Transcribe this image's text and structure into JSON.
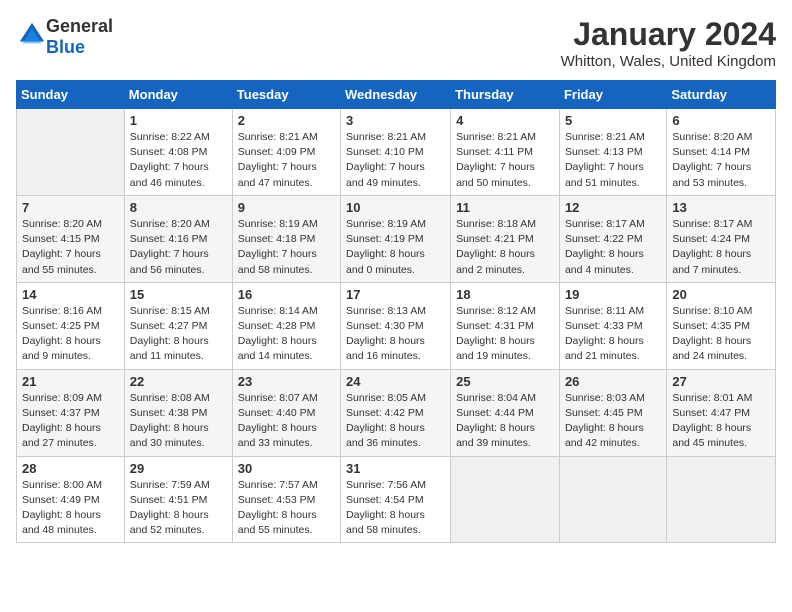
{
  "logo": {
    "general": "General",
    "blue": "Blue"
  },
  "header": {
    "title": "January 2024",
    "subtitle": "Whitton, Wales, United Kingdom"
  },
  "days_of_week": [
    "Sunday",
    "Monday",
    "Tuesday",
    "Wednesday",
    "Thursday",
    "Friday",
    "Saturday"
  ],
  "weeks": [
    [
      {
        "day": "",
        "empty": true
      },
      {
        "day": "1",
        "sunrise": "8:22 AM",
        "sunset": "4:08 PM",
        "daylight": "7 hours and 46 minutes."
      },
      {
        "day": "2",
        "sunrise": "8:21 AM",
        "sunset": "4:09 PM",
        "daylight": "7 hours and 47 minutes."
      },
      {
        "day": "3",
        "sunrise": "8:21 AM",
        "sunset": "4:10 PM",
        "daylight": "7 hours and 49 minutes."
      },
      {
        "day": "4",
        "sunrise": "8:21 AM",
        "sunset": "4:11 PM",
        "daylight": "7 hours and 50 minutes."
      },
      {
        "day": "5",
        "sunrise": "8:21 AM",
        "sunset": "4:13 PM",
        "daylight": "7 hours and 51 minutes."
      },
      {
        "day": "6",
        "sunrise": "8:20 AM",
        "sunset": "4:14 PM",
        "daylight": "7 hours and 53 minutes."
      }
    ],
    [
      {
        "day": "7",
        "sunrise": "8:20 AM",
        "sunset": "4:15 PM",
        "daylight": "7 hours and 55 minutes."
      },
      {
        "day": "8",
        "sunrise": "8:20 AM",
        "sunset": "4:16 PM",
        "daylight": "7 hours and 56 minutes."
      },
      {
        "day": "9",
        "sunrise": "8:19 AM",
        "sunset": "4:18 PM",
        "daylight": "7 hours and 58 minutes."
      },
      {
        "day": "10",
        "sunrise": "8:19 AM",
        "sunset": "4:19 PM",
        "daylight": "8 hours and 0 minutes."
      },
      {
        "day": "11",
        "sunrise": "8:18 AM",
        "sunset": "4:21 PM",
        "daylight": "8 hours and 2 minutes."
      },
      {
        "day": "12",
        "sunrise": "8:17 AM",
        "sunset": "4:22 PM",
        "daylight": "8 hours and 4 minutes."
      },
      {
        "day": "13",
        "sunrise": "8:17 AM",
        "sunset": "4:24 PM",
        "daylight": "8 hours and 7 minutes."
      }
    ],
    [
      {
        "day": "14",
        "sunrise": "8:16 AM",
        "sunset": "4:25 PM",
        "daylight": "8 hours and 9 minutes."
      },
      {
        "day": "15",
        "sunrise": "8:15 AM",
        "sunset": "4:27 PM",
        "daylight": "8 hours and 11 minutes."
      },
      {
        "day": "16",
        "sunrise": "8:14 AM",
        "sunset": "4:28 PM",
        "daylight": "8 hours and 14 minutes."
      },
      {
        "day": "17",
        "sunrise": "8:13 AM",
        "sunset": "4:30 PM",
        "daylight": "8 hours and 16 minutes."
      },
      {
        "day": "18",
        "sunrise": "8:12 AM",
        "sunset": "4:31 PM",
        "daylight": "8 hours and 19 minutes."
      },
      {
        "day": "19",
        "sunrise": "8:11 AM",
        "sunset": "4:33 PM",
        "daylight": "8 hours and 21 minutes."
      },
      {
        "day": "20",
        "sunrise": "8:10 AM",
        "sunset": "4:35 PM",
        "daylight": "8 hours and 24 minutes."
      }
    ],
    [
      {
        "day": "21",
        "sunrise": "8:09 AM",
        "sunset": "4:37 PM",
        "daylight": "8 hours and 27 minutes."
      },
      {
        "day": "22",
        "sunrise": "8:08 AM",
        "sunset": "4:38 PM",
        "daylight": "8 hours and 30 minutes."
      },
      {
        "day": "23",
        "sunrise": "8:07 AM",
        "sunset": "4:40 PM",
        "daylight": "8 hours and 33 minutes."
      },
      {
        "day": "24",
        "sunrise": "8:05 AM",
        "sunset": "4:42 PM",
        "daylight": "8 hours and 36 minutes."
      },
      {
        "day": "25",
        "sunrise": "8:04 AM",
        "sunset": "4:44 PM",
        "daylight": "8 hours and 39 minutes."
      },
      {
        "day": "26",
        "sunrise": "8:03 AM",
        "sunset": "4:45 PM",
        "daylight": "8 hours and 42 minutes."
      },
      {
        "day": "27",
        "sunrise": "8:01 AM",
        "sunset": "4:47 PM",
        "daylight": "8 hours and 45 minutes."
      }
    ],
    [
      {
        "day": "28",
        "sunrise": "8:00 AM",
        "sunset": "4:49 PM",
        "daylight": "8 hours and 48 minutes."
      },
      {
        "day": "29",
        "sunrise": "7:59 AM",
        "sunset": "4:51 PM",
        "daylight": "8 hours and 52 minutes."
      },
      {
        "day": "30",
        "sunrise": "7:57 AM",
        "sunset": "4:53 PM",
        "daylight": "8 hours and 55 minutes."
      },
      {
        "day": "31",
        "sunrise": "7:56 AM",
        "sunset": "4:54 PM",
        "daylight": "8 hours and 58 minutes."
      },
      {
        "day": "",
        "empty": true
      },
      {
        "day": "",
        "empty": true
      },
      {
        "day": "",
        "empty": true
      }
    ]
  ]
}
